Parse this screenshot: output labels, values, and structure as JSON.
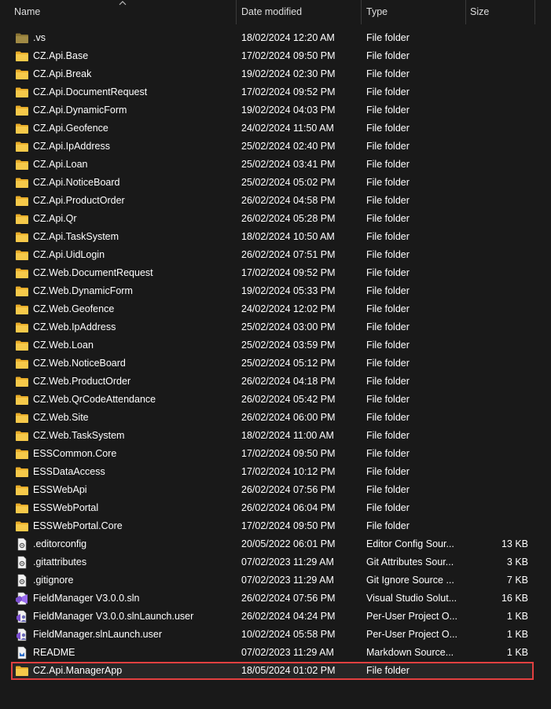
{
  "columns": {
    "name": "Name",
    "date": "Date modified",
    "type": "Type",
    "size": "Size"
  },
  "colors": {
    "background": "#191919",
    "folder": "#f3c13a",
    "highlight_border": "#e04040"
  },
  "rows": [
    {
      "name": ".vs",
      "date": "18/02/2024 12:20 AM",
      "type": "File folder",
      "size": "",
      "icon": "folder-dim-icon"
    },
    {
      "name": "CZ.Api.Base",
      "date": "17/02/2024 09:50 PM",
      "type": "File folder",
      "size": "",
      "icon": "folder-icon"
    },
    {
      "name": "CZ.Api.Break",
      "date": "19/02/2024 02:30 PM",
      "type": "File folder",
      "size": "",
      "icon": "folder-icon"
    },
    {
      "name": "CZ.Api.DocumentRequest",
      "date": "17/02/2024 09:52 PM",
      "type": "File folder",
      "size": "",
      "icon": "folder-icon"
    },
    {
      "name": "CZ.Api.DynamicForm",
      "date": "19/02/2024 04:03 PM",
      "type": "File folder",
      "size": "",
      "icon": "folder-icon"
    },
    {
      "name": "CZ.Api.Geofence",
      "date": "24/02/2024 11:50 AM",
      "type": "File folder",
      "size": "",
      "icon": "folder-icon"
    },
    {
      "name": "CZ.Api.IpAddress",
      "date": "25/02/2024 02:40 PM",
      "type": "File folder",
      "size": "",
      "icon": "folder-icon"
    },
    {
      "name": "CZ.Api.Loan",
      "date": "25/02/2024 03:41 PM",
      "type": "File folder",
      "size": "",
      "icon": "folder-icon"
    },
    {
      "name": "CZ.Api.NoticeBoard",
      "date": "25/02/2024 05:02 PM",
      "type": "File folder",
      "size": "",
      "icon": "folder-icon"
    },
    {
      "name": "CZ.Api.ProductOrder",
      "date": "26/02/2024 04:58 PM",
      "type": "File folder",
      "size": "",
      "icon": "folder-icon"
    },
    {
      "name": "CZ.Api.Qr",
      "date": "26/02/2024 05:28 PM",
      "type": "File folder",
      "size": "",
      "icon": "folder-icon"
    },
    {
      "name": "CZ.Api.TaskSystem",
      "date": "18/02/2024 10:50 AM",
      "type": "File folder",
      "size": "",
      "icon": "folder-icon"
    },
    {
      "name": "CZ.Api.UidLogin",
      "date": "26/02/2024 07:51 PM",
      "type": "File folder",
      "size": "",
      "icon": "folder-icon"
    },
    {
      "name": "CZ.Web.DocumentRequest",
      "date": "17/02/2024 09:52 PM",
      "type": "File folder",
      "size": "",
      "icon": "folder-icon"
    },
    {
      "name": "CZ.Web.DynamicForm",
      "date": "19/02/2024 05:33 PM",
      "type": "File folder",
      "size": "",
      "icon": "folder-icon"
    },
    {
      "name": "CZ.Web.Geofence",
      "date": "24/02/2024 12:02 PM",
      "type": "File folder",
      "size": "",
      "icon": "folder-icon"
    },
    {
      "name": "CZ.Web.IpAddress",
      "date": "25/02/2024 03:00 PM",
      "type": "File folder",
      "size": "",
      "icon": "folder-icon"
    },
    {
      "name": "CZ.Web.Loan",
      "date": "25/02/2024 03:59 PM",
      "type": "File folder",
      "size": "",
      "icon": "folder-icon"
    },
    {
      "name": "CZ.Web.NoticeBoard",
      "date": "25/02/2024 05:12 PM",
      "type": "File folder",
      "size": "",
      "icon": "folder-icon"
    },
    {
      "name": "CZ.Web.ProductOrder",
      "date": "26/02/2024 04:18 PM",
      "type": "File folder",
      "size": "",
      "icon": "folder-icon"
    },
    {
      "name": "CZ.Web.QrCodeAttendance",
      "date": "26/02/2024 05:42 PM",
      "type": "File folder",
      "size": "",
      "icon": "folder-icon"
    },
    {
      "name": "CZ.Web.Site",
      "date": "26/02/2024 06:00 PM",
      "type": "File folder",
      "size": "",
      "icon": "folder-icon"
    },
    {
      "name": "CZ.Web.TaskSystem",
      "date": "18/02/2024 11:00 AM",
      "type": "File folder",
      "size": "",
      "icon": "folder-icon"
    },
    {
      "name": "ESSCommon.Core",
      "date": "17/02/2024 09:50 PM",
      "type": "File folder",
      "size": "",
      "icon": "folder-icon"
    },
    {
      "name": "ESSDataAccess",
      "date": "17/02/2024 10:12 PM",
      "type": "File folder",
      "size": "",
      "icon": "folder-icon"
    },
    {
      "name": "ESSWebApi",
      "date": "26/02/2024 07:56 PM",
      "type": "File folder",
      "size": "",
      "icon": "folder-icon"
    },
    {
      "name": "ESSWebPortal",
      "date": "26/02/2024 06:04 PM",
      "type": "File folder",
      "size": "",
      "icon": "folder-icon"
    },
    {
      "name": "ESSWebPortal.Core",
      "date": "17/02/2024 09:50 PM",
      "type": "File folder",
      "size": "",
      "icon": "folder-icon"
    },
    {
      "name": ".editorconfig",
      "date": "20/05/2022 06:01 PM",
      "type": "Editor Config Sour...",
      "size": "13 KB",
      "icon": "config-file-icon"
    },
    {
      "name": ".gitattributes",
      "date": "07/02/2023 11:29 AM",
      "type": "Git Attributes Sour...",
      "size": "3 KB",
      "icon": "config-file-icon"
    },
    {
      "name": ".gitignore",
      "date": "07/02/2023 11:29 AM",
      "type": "Git Ignore Source ...",
      "size": "7 KB",
      "icon": "config-file-icon"
    },
    {
      "name": "FieldManager V3.0.0.sln",
      "date": "26/02/2024 07:56 PM",
      "type": "Visual Studio Solut...",
      "size": "16 KB",
      "icon": "visual-studio-solution-icon"
    },
    {
      "name": "FieldManager V3.0.0.slnLaunch.user",
      "date": "26/02/2024 04:24 PM",
      "type": "Per-User Project O...",
      "size": "1 KB",
      "icon": "user-project-file-icon"
    },
    {
      "name": "FieldManager.slnLaunch.user",
      "date": "10/02/2024 05:58 PM",
      "type": "Per-User Project O...",
      "size": "1 KB",
      "icon": "user-project-file-icon"
    },
    {
      "name": "README",
      "date": "07/02/2023 11:29 AM",
      "type": "Markdown Source...",
      "size": "1 KB",
      "icon": "markdown-file-icon"
    },
    {
      "name": "CZ.Api.ManagerApp",
      "date": "18/05/2024 01:02 PM",
      "type": "File folder",
      "size": "",
      "icon": "folder-icon",
      "highlighted": true
    }
  ]
}
